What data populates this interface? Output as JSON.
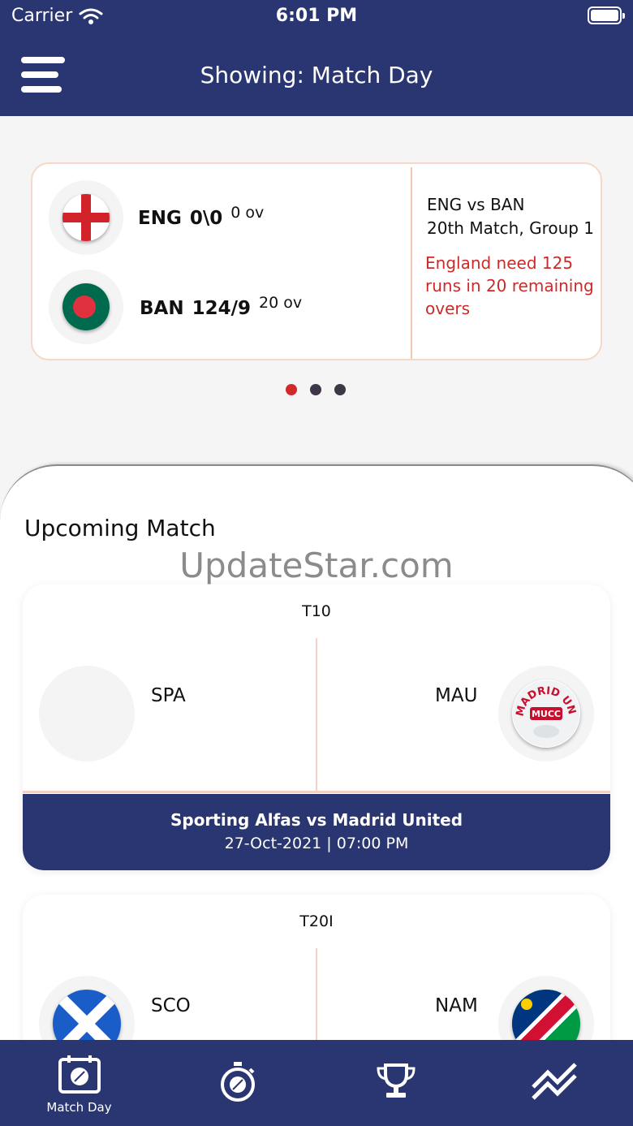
{
  "status_bar": {
    "carrier": "Carrier",
    "time": "6:01 PM"
  },
  "header": {
    "prefix": "Showing: ",
    "value": "Match Day"
  },
  "live_match": {
    "team1": {
      "code": "ENG",
      "score": "0\\0",
      "overs": "0 ov"
    },
    "team2": {
      "code": "BAN",
      "score": "124/9",
      "overs": "20 ov"
    },
    "fixture": "ENG vs BAN",
    "stage": "20th Match, Group 1",
    "status": "England need 125 runs in 20 remaining overs",
    "status_color": "#cc2a2a"
  },
  "carousel": {
    "page_count": 3,
    "active_page": 1
  },
  "upcoming": {
    "title": "Upcoming Match",
    "watermark": "UpdateStar.com",
    "matches": [
      {
        "format": "T10",
        "home": "SPA",
        "away": "MAU",
        "away_logo_text": "MADRID UNITED CC",
        "away_logo_badge": "MUCC",
        "title": "Sporting Alfas vs Madrid United",
        "datetime": "27-Oct-2021 | 07:00 PM"
      },
      {
        "format": "T20I",
        "home": "SCO",
        "away": "NAM"
      }
    ]
  },
  "tab_bar": {
    "tabs": [
      {
        "label": "Match Day",
        "icon": "calendar-ball-icon"
      },
      {
        "label": "",
        "icon": "stopwatch-icon"
      },
      {
        "label": "",
        "icon": "trophy-icon"
      },
      {
        "label": "",
        "icon": "trend-icon"
      }
    ]
  },
  "colors": {
    "primary": "#2a3672",
    "accent_red": "#d22a2a",
    "divider": "#f0c9b5"
  }
}
